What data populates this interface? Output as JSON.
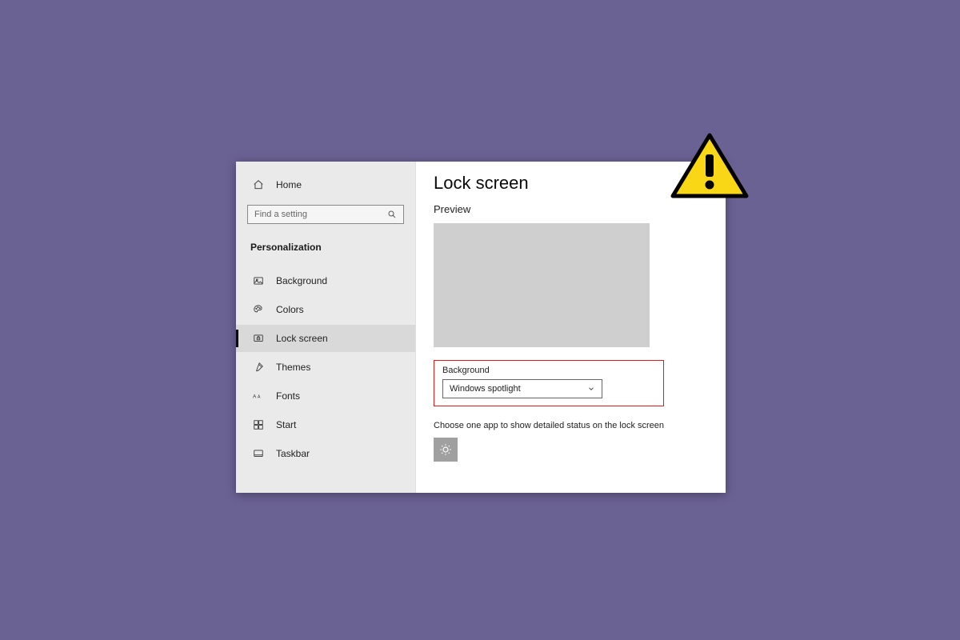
{
  "sidebar": {
    "home_label": "Home",
    "search_placeholder": "Find a setting",
    "section_title": "Personalization",
    "items": [
      {
        "label": "Background"
      },
      {
        "label": "Colors"
      },
      {
        "label": "Lock screen"
      },
      {
        "label": "Themes"
      },
      {
        "label": "Fonts"
      },
      {
        "label": "Start"
      },
      {
        "label": "Taskbar"
      }
    ]
  },
  "main": {
    "page_title": "Lock screen",
    "preview_label": "Preview",
    "background_label": "Background",
    "dropdown_value": "Windows spotlight",
    "status_text": "Choose one app to show detailed status on the lock screen"
  }
}
